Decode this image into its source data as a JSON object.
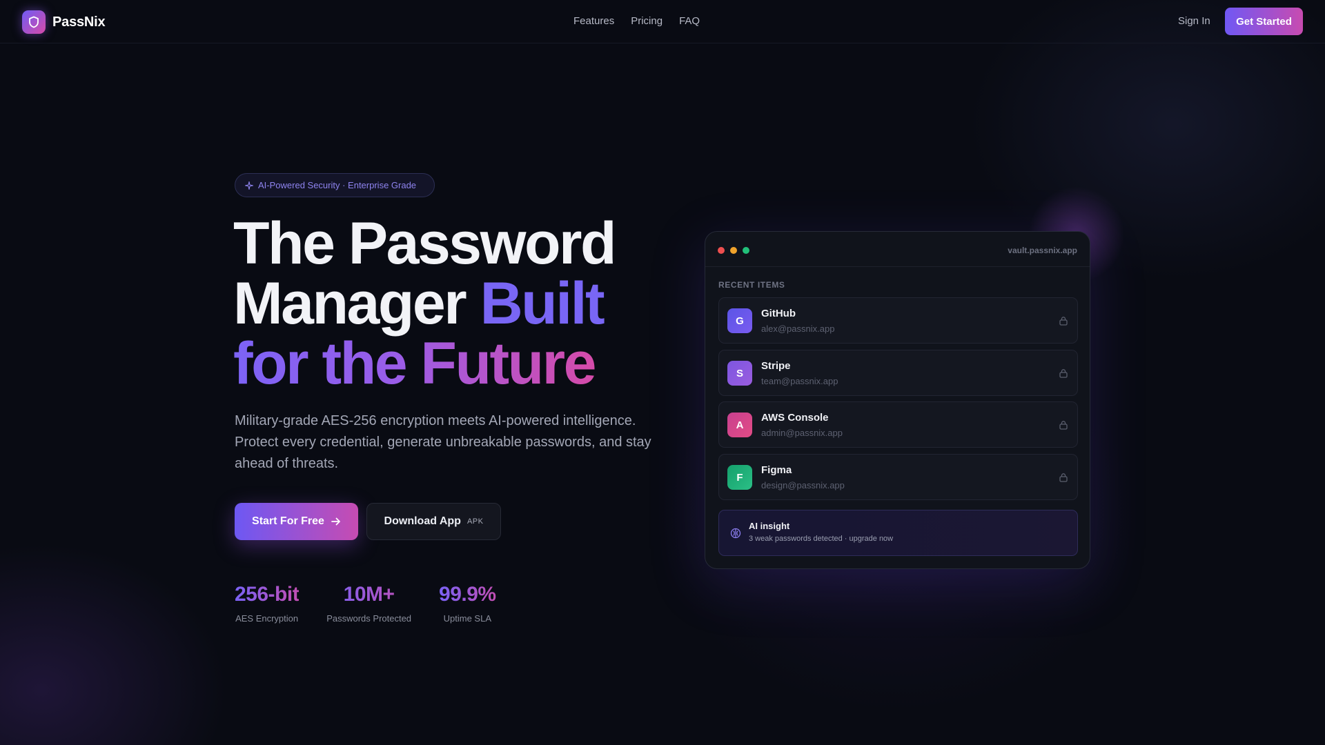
{
  "brand": {
    "name": "PassNix"
  },
  "nav": {
    "links": [
      "Features",
      "Pricing",
      "FAQ"
    ],
    "sign_in": "Sign In",
    "cta": "Get Started"
  },
  "hero": {
    "badge": "AI-Powered Security · Enterprise Grade",
    "headline_line1": "The Password",
    "headline_line2_a": "Manager ",
    "headline_line2_b": "Built",
    "headline_line3": "for the Future",
    "subtext": "Military-grade AES-256 encryption meets AI-powered intelligence. Protect every credential, generate unbreakable passwords, and stay ahead of threats.",
    "primary_button": "Start For Free",
    "secondary_button": "Download App",
    "secondary_button_tag": "APK"
  },
  "stats": [
    {
      "value": "256-bit",
      "label": "AES Encryption"
    },
    {
      "value": "10M+",
      "label": "Passwords Protected"
    },
    {
      "value": "99.9%",
      "label": "Uptime SLA"
    }
  ],
  "vault": {
    "url": "vault.passnix.app",
    "recent_label": "RECENT ITEMS",
    "items": [
      {
        "initial": "G",
        "name": "GitHub",
        "email": "alex@passnix.app",
        "color": "#5b54e6"
      },
      {
        "initial": "S",
        "name": "Stripe",
        "email": "team@passnix.app",
        "color": "#8156e0"
      },
      {
        "initial": "A",
        "name": "AWS Console",
        "email": "admin@passnix.app",
        "color": "#d1408a"
      },
      {
        "initial": "F",
        "name": "Figma",
        "email": "design@passnix.app",
        "color": "#1ea772"
      }
    ],
    "insight": {
      "title": "AI insight",
      "text": "3 weak passwords detected · upgrade now"
    }
  },
  "colors": {
    "accent_start": "#6f5cf5",
    "accent_end": "#d64aa8",
    "background": "#090b13",
    "dot_red": "#ee4f4f",
    "dot_yellow": "#f0a32c",
    "dot_green": "#22c07a"
  },
  "icons": {
    "logo": "shield-icon",
    "badge": "sparkle-icon",
    "primary_button": "arrow-right-icon",
    "item": "lock-icon",
    "insight": "brain-icon"
  }
}
